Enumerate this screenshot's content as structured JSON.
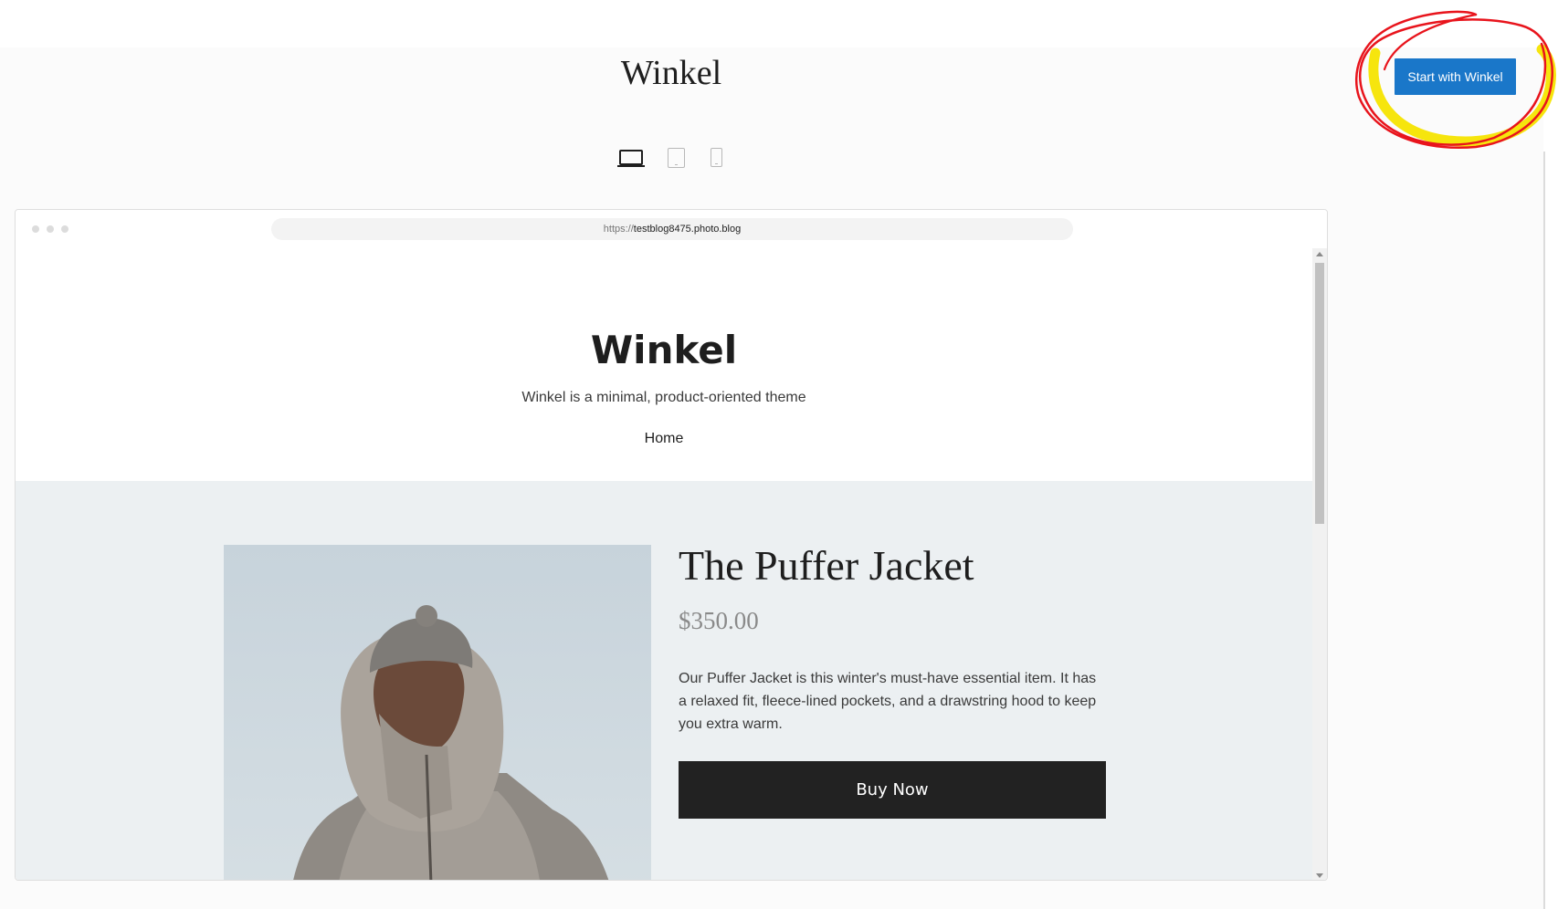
{
  "header": {
    "theme_title": "Winkel",
    "cta_label": "Start with Winkel",
    "devices": [
      "desktop-icon",
      "tablet-icon",
      "mobile-icon"
    ],
    "active_device": "desktop"
  },
  "browser": {
    "url_scheme": "https://",
    "url_host": "testblog8475.photo.blog"
  },
  "site": {
    "title": "Winkel",
    "tagline": "Winkel is a minimal, product-oriented theme",
    "nav": [
      "Home"
    ]
  },
  "product": {
    "title": "The Puffer Jacket",
    "price": "$350.00",
    "description": "Our Puffer Jacket is this winter's must-have essential item. It has a relaxed fit, fleece-lined pockets, and a drawstring hood to keep you extra warm.",
    "cta": "Buy Now"
  },
  "colors": {
    "accent": "#1a77c9",
    "buy_button": "#222222",
    "hero_background": "#ecf0f2",
    "annotation_red": "#e8141c",
    "annotation_yellow": "#f5e400"
  }
}
